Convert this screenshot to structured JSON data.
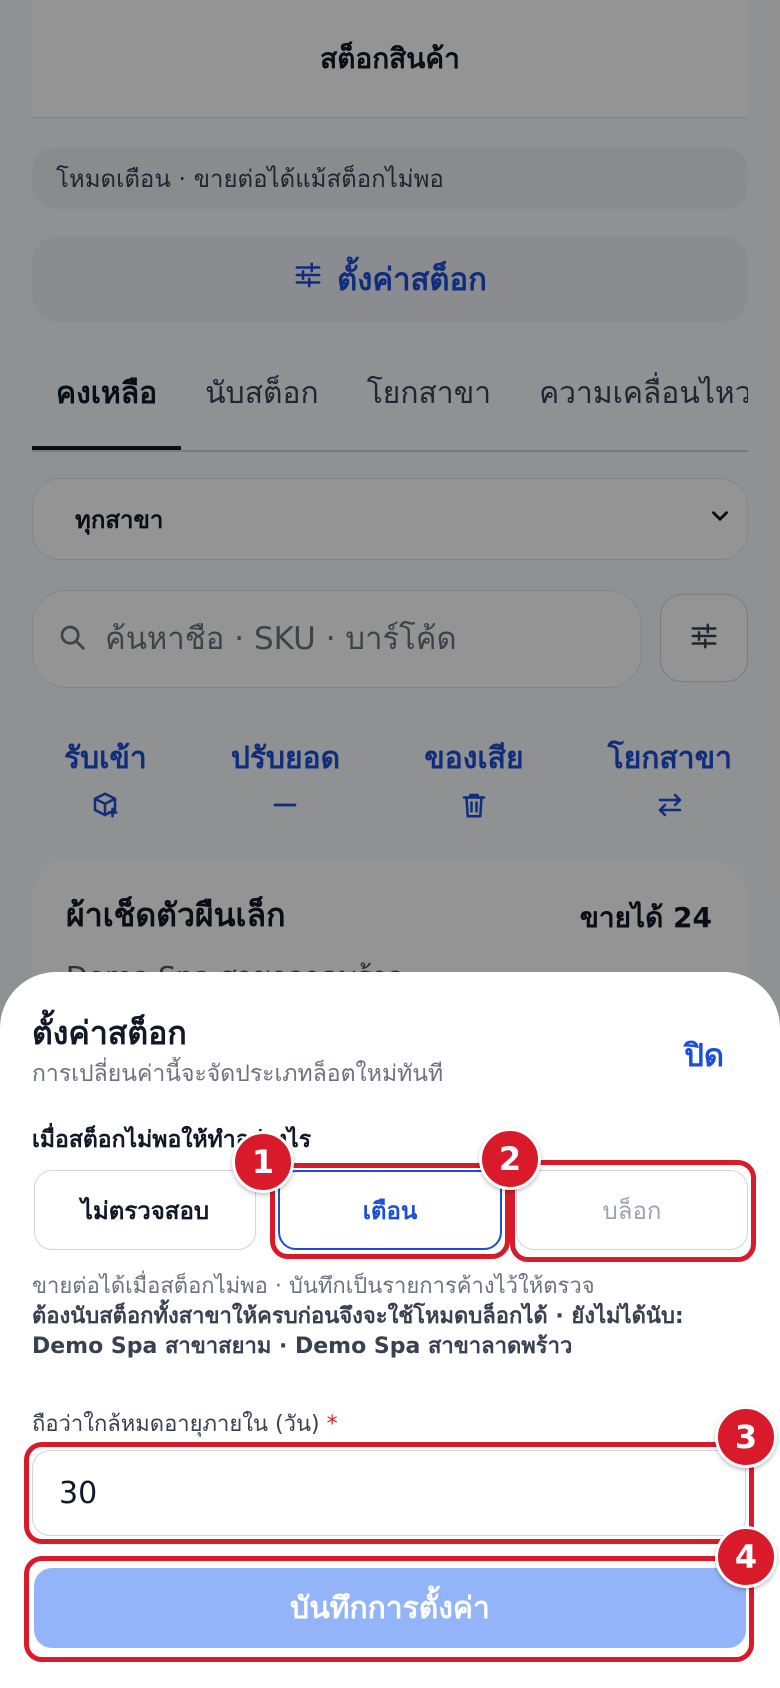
{
  "header": {
    "title": "สต็อกสินค้า"
  },
  "mode_banner": "โหมดเตือน · ขายต่อได้แม้สต็อกไม่พอ",
  "settings_button": {
    "label": "ตั้งค่าสต็อก",
    "icon": "sliders-icon"
  },
  "tabs": [
    {
      "label": "คงเหลือ",
      "active": true
    },
    {
      "label": "นับสต็อก",
      "active": false
    },
    {
      "label": "โยกสาขา",
      "active": false
    },
    {
      "label": "ความเคลื่อนไหว",
      "active": false
    }
  ],
  "branch_filter": {
    "value": "ทุกสาขา"
  },
  "search": {
    "placeholder": "ค้นหาชื่อ · SKU · บาร์โค้ด"
  },
  "actions": [
    {
      "label": "รับเข้า",
      "icon": "package-plus-icon"
    },
    {
      "label": "ปรับยอด",
      "icon": "minus-icon"
    },
    {
      "label": "ของเสีย",
      "icon": "trash-icon"
    },
    {
      "label": "โยกสาขา",
      "icon": "transfer-arrows-icon"
    }
  ],
  "product_card": {
    "name": "ผ้าเช็ดตัวผืนเล็ก",
    "available": "ขายได้ 24",
    "branch": "Demo Spa สาขาลาดพร้าว"
  },
  "sheet": {
    "title": "ตั้งค่าสต็อก",
    "close_label": "ปิด",
    "description": "การเปลี่ยนค่านี้จะจัดประเภทล็อตใหม่ทันที",
    "question": "เมื่อสต็อกไม่พอให้ทำอย่างไร",
    "options": {
      "off": "ไม่ตรวจสอบ",
      "warn": "เตือน",
      "block": "บล็อก"
    },
    "selected_option": "warn",
    "hint_warn": "ขายต่อได้เมื่อสต็อกไม่พอ · บันทึกเป็นรายการค้างไว้ให้ตรวจ",
    "hint_block": "ต้องนับสต็อกทั้งสาขาให้ครบก่อนจึงจะใช้โหมดบล็อกได้ · ยังไม่ได้นับ: Demo Spa สาขาสยาม · Demo Spa สาขาลาดพร้าว",
    "days_label": "ถือว่าใกล้หมดอายุภายใน (วัน)",
    "days_required_mark": "*",
    "days_value": "30",
    "save_label": "บันทึกการตั้งค่า"
  },
  "annotations": {
    "one": "1",
    "two": "2",
    "three": "3",
    "four": "4"
  },
  "colors": {
    "accent": "#1d4ed8",
    "save_disabled": "#93b4f8",
    "annotation": "#d91a2a"
  }
}
